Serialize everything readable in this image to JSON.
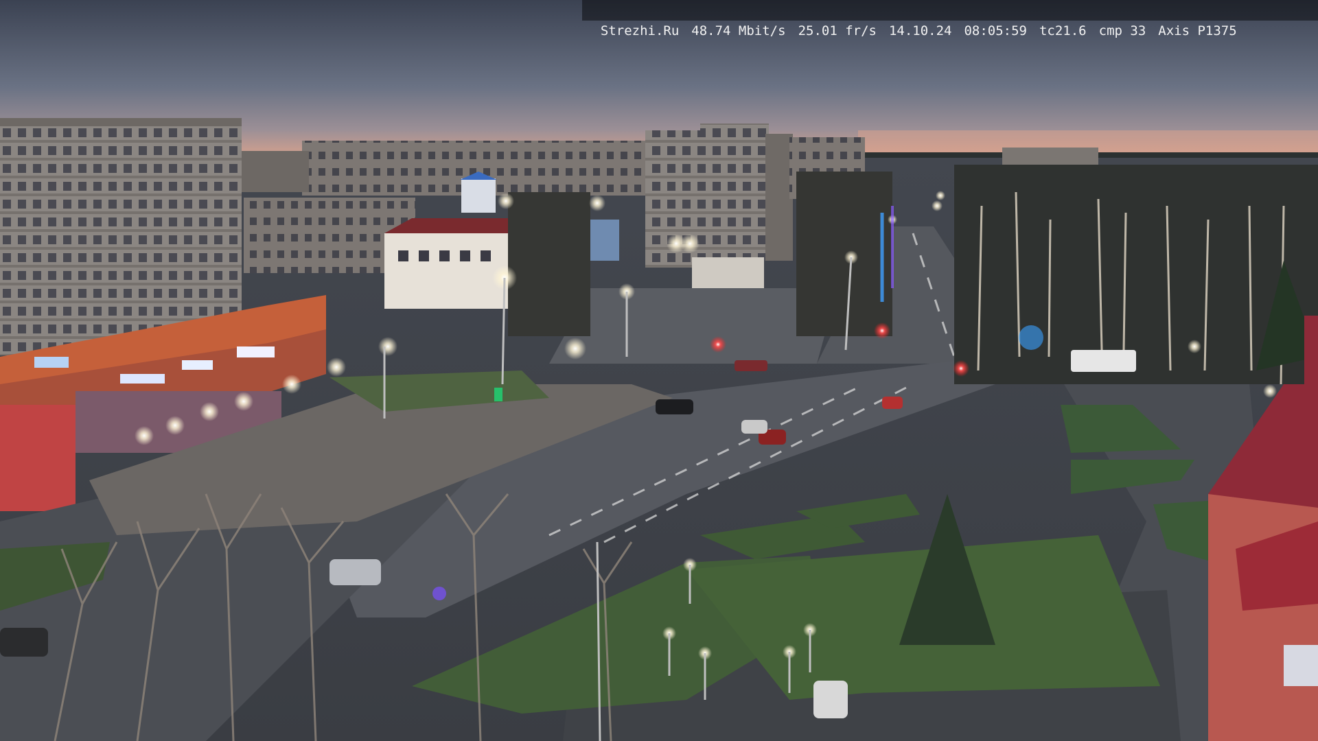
{
  "overlay": {
    "site": "Strezhi.Ru",
    "bitrate": "48.74 Mbit/s",
    "framerate": "25.01 fr/s",
    "date": "14.10.24",
    "time": "08:05:59",
    "tc": "tc21.6",
    "cmp": "cmp 33",
    "camera": "Axis P1375"
  },
  "scene": {
    "description_icon": "camera-feed",
    "colors": {
      "sky_top": "#3f4656",
      "sky_mid": "#6b7385",
      "sky_horizon": "#c89a8a",
      "street_light": "#fff6d8",
      "grass": "#3f5a35",
      "asphalt": "#4c4f55"
    }
  }
}
